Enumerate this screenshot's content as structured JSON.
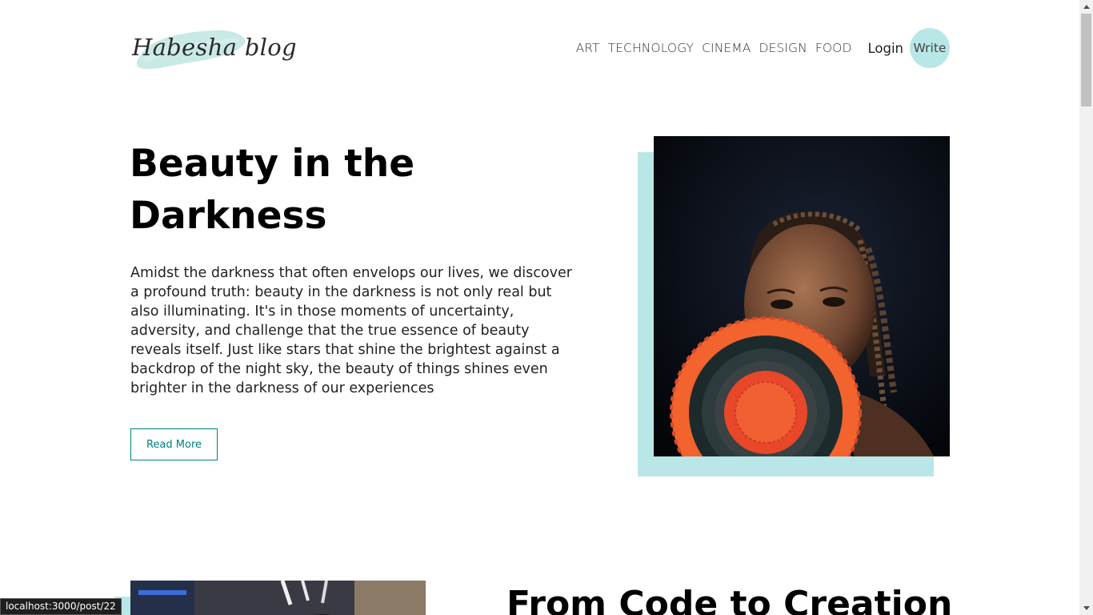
{
  "navbar": {
    "logo_text": "Habesha blog",
    "links": [
      "ART",
      "TECHNOLOGY",
      "CINEMA",
      "DESIGN",
      "FOOD"
    ],
    "login_label": "Login",
    "write_label": "Write"
  },
  "posts": [
    {
      "title": "Beauty in the Darkness",
      "description": "Amidst the darkness that often envelops our lives, we discover a profound truth: beauty in the darkness is not only real but also illuminating. It's in those moments of uncertainty, adversity, and challenge that the true essence of beauty reveals itself. Just like stars that shine the brightest against a backdrop of the night sky, the beauty of things shines even brighter in the darkness of our experiences",
      "button_label": "Read More"
    },
    {
      "title": "From Code to Creation"
    }
  ],
  "status_bar": {
    "url": "localhost:3000/post/22"
  },
  "colors": {
    "accent": "#b9e6e6",
    "button_border": "#008080"
  }
}
